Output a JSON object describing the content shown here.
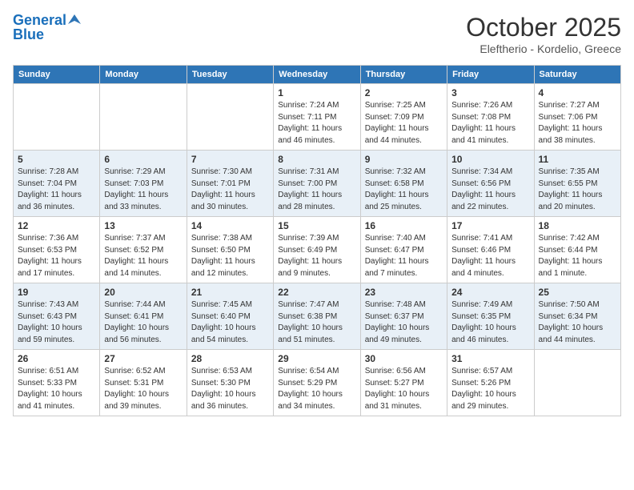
{
  "logo": {
    "line1": "General",
    "line2": "Blue"
  },
  "title": "October 2025",
  "subtitle": "Eleftherio - Kordelio, Greece",
  "days_of_week": [
    "Sunday",
    "Monday",
    "Tuesday",
    "Wednesday",
    "Thursday",
    "Friday",
    "Saturday"
  ],
  "weeks": [
    [
      {
        "day": "",
        "info": ""
      },
      {
        "day": "",
        "info": ""
      },
      {
        "day": "",
        "info": ""
      },
      {
        "day": "1",
        "info": "Sunrise: 7:24 AM\nSunset: 7:11 PM\nDaylight: 11 hours and 46 minutes."
      },
      {
        "day": "2",
        "info": "Sunrise: 7:25 AM\nSunset: 7:09 PM\nDaylight: 11 hours and 44 minutes."
      },
      {
        "day": "3",
        "info": "Sunrise: 7:26 AM\nSunset: 7:08 PM\nDaylight: 11 hours and 41 minutes."
      },
      {
        "day": "4",
        "info": "Sunrise: 7:27 AM\nSunset: 7:06 PM\nDaylight: 11 hours and 38 minutes."
      }
    ],
    [
      {
        "day": "5",
        "info": "Sunrise: 7:28 AM\nSunset: 7:04 PM\nDaylight: 11 hours and 36 minutes."
      },
      {
        "day": "6",
        "info": "Sunrise: 7:29 AM\nSunset: 7:03 PM\nDaylight: 11 hours and 33 minutes."
      },
      {
        "day": "7",
        "info": "Sunrise: 7:30 AM\nSunset: 7:01 PM\nDaylight: 11 hours and 30 minutes."
      },
      {
        "day": "8",
        "info": "Sunrise: 7:31 AM\nSunset: 7:00 PM\nDaylight: 11 hours and 28 minutes."
      },
      {
        "day": "9",
        "info": "Sunrise: 7:32 AM\nSunset: 6:58 PM\nDaylight: 11 hours and 25 minutes."
      },
      {
        "day": "10",
        "info": "Sunrise: 7:34 AM\nSunset: 6:56 PM\nDaylight: 11 hours and 22 minutes."
      },
      {
        "day": "11",
        "info": "Sunrise: 7:35 AM\nSunset: 6:55 PM\nDaylight: 11 hours and 20 minutes."
      }
    ],
    [
      {
        "day": "12",
        "info": "Sunrise: 7:36 AM\nSunset: 6:53 PM\nDaylight: 11 hours and 17 minutes."
      },
      {
        "day": "13",
        "info": "Sunrise: 7:37 AM\nSunset: 6:52 PM\nDaylight: 11 hours and 14 minutes."
      },
      {
        "day": "14",
        "info": "Sunrise: 7:38 AM\nSunset: 6:50 PM\nDaylight: 11 hours and 12 minutes."
      },
      {
        "day": "15",
        "info": "Sunrise: 7:39 AM\nSunset: 6:49 PM\nDaylight: 11 hours and 9 minutes."
      },
      {
        "day": "16",
        "info": "Sunrise: 7:40 AM\nSunset: 6:47 PM\nDaylight: 11 hours and 7 minutes."
      },
      {
        "day": "17",
        "info": "Sunrise: 7:41 AM\nSunset: 6:46 PM\nDaylight: 11 hours and 4 minutes."
      },
      {
        "day": "18",
        "info": "Sunrise: 7:42 AM\nSunset: 6:44 PM\nDaylight: 11 hours and 1 minute."
      }
    ],
    [
      {
        "day": "19",
        "info": "Sunrise: 7:43 AM\nSunset: 6:43 PM\nDaylight: 10 hours and 59 minutes."
      },
      {
        "day": "20",
        "info": "Sunrise: 7:44 AM\nSunset: 6:41 PM\nDaylight: 10 hours and 56 minutes."
      },
      {
        "day": "21",
        "info": "Sunrise: 7:45 AM\nSunset: 6:40 PM\nDaylight: 10 hours and 54 minutes."
      },
      {
        "day": "22",
        "info": "Sunrise: 7:47 AM\nSunset: 6:38 PM\nDaylight: 10 hours and 51 minutes."
      },
      {
        "day": "23",
        "info": "Sunrise: 7:48 AM\nSunset: 6:37 PM\nDaylight: 10 hours and 49 minutes."
      },
      {
        "day": "24",
        "info": "Sunrise: 7:49 AM\nSunset: 6:35 PM\nDaylight: 10 hours and 46 minutes."
      },
      {
        "day": "25",
        "info": "Sunrise: 7:50 AM\nSunset: 6:34 PM\nDaylight: 10 hours and 44 minutes."
      }
    ],
    [
      {
        "day": "26",
        "info": "Sunrise: 6:51 AM\nSunset: 5:33 PM\nDaylight: 10 hours and 41 minutes."
      },
      {
        "day": "27",
        "info": "Sunrise: 6:52 AM\nSunset: 5:31 PM\nDaylight: 10 hours and 39 minutes."
      },
      {
        "day": "28",
        "info": "Sunrise: 6:53 AM\nSunset: 5:30 PM\nDaylight: 10 hours and 36 minutes."
      },
      {
        "day": "29",
        "info": "Sunrise: 6:54 AM\nSunset: 5:29 PM\nDaylight: 10 hours and 34 minutes."
      },
      {
        "day": "30",
        "info": "Sunrise: 6:56 AM\nSunset: 5:27 PM\nDaylight: 10 hours and 31 minutes."
      },
      {
        "day": "31",
        "info": "Sunrise: 6:57 AM\nSunset: 5:26 PM\nDaylight: 10 hours and 29 minutes."
      },
      {
        "day": "",
        "info": ""
      }
    ]
  ]
}
